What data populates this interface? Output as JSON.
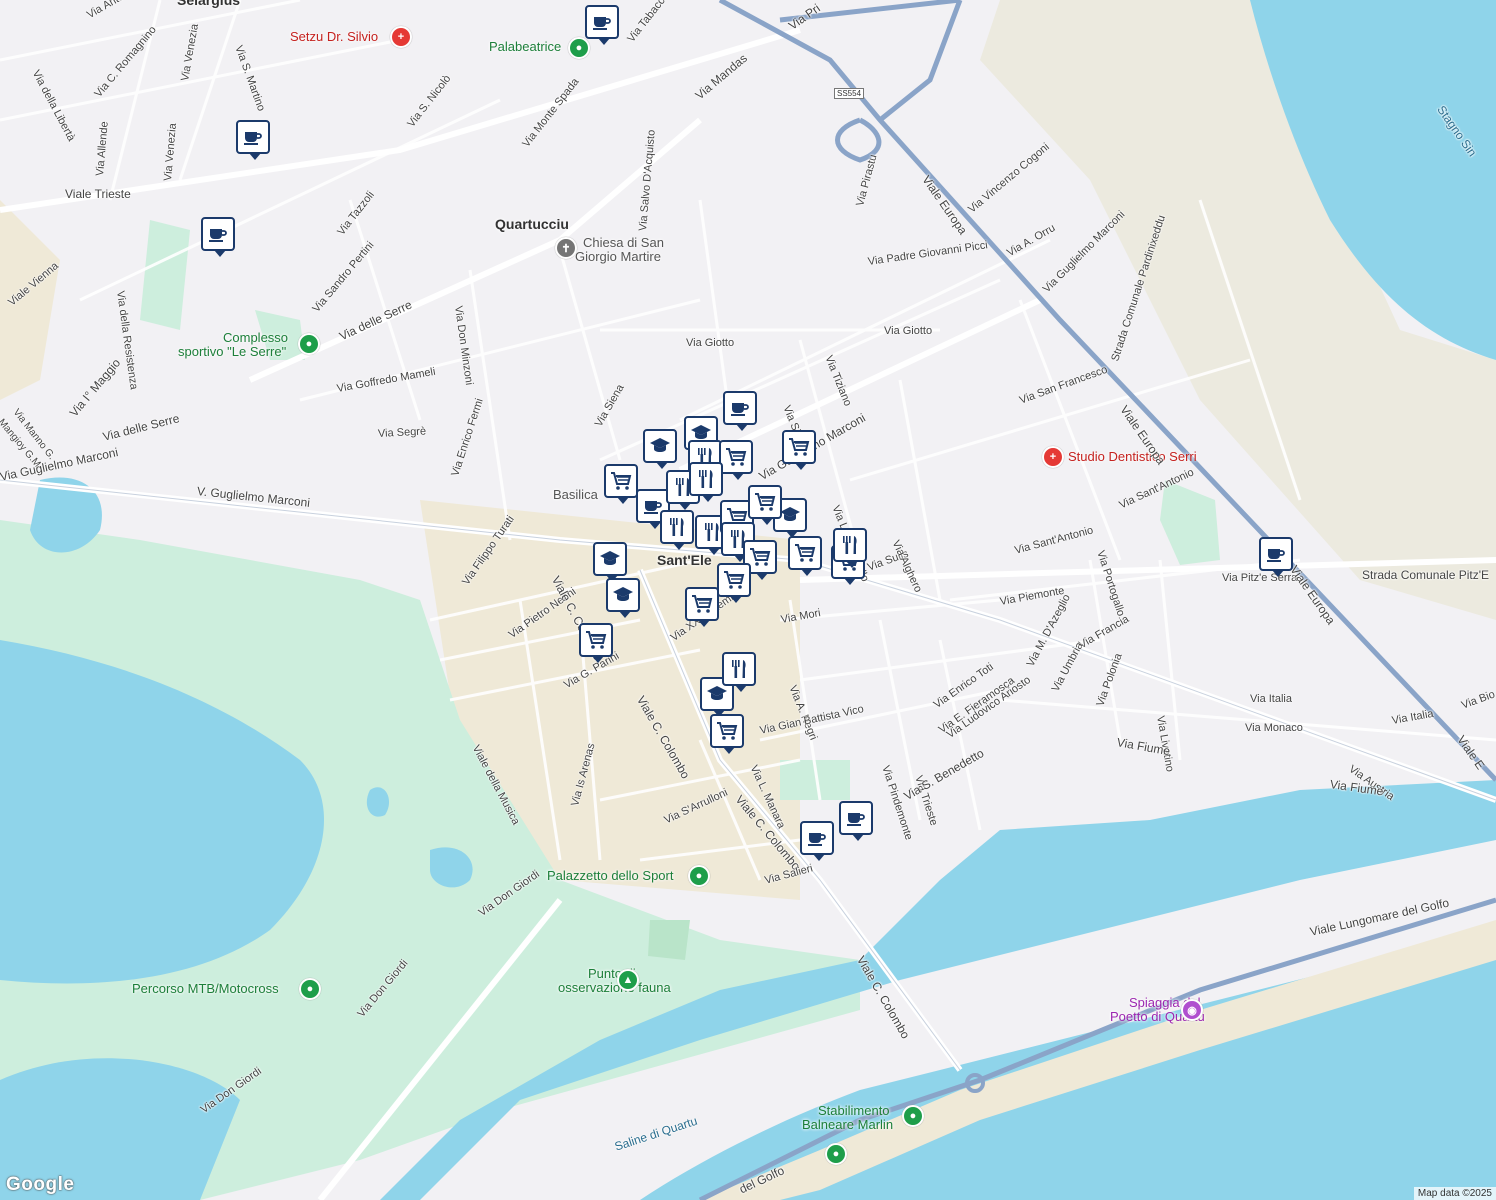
{
  "colors": {
    "water": "#8fd4ea",
    "park": "#cdeedd",
    "sand": "#efe9d7",
    "road_major": "#8aa4c8",
    "marker": "#1b3a6b"
  },
  "places": {
    "selargius": "Selargius",
    "quartucciu": "Quartucciu",
    "santelena": "Sant'Ele",
    "basilica": "Basilica"
  },
  "pois": {
    "setzu": "Setzu Dr. Silvio",
    "palabeatrice": "Palabeatrice",
    "chiesa1": "Chiesa di San",
    "chiesa2": "Giorgio Martire",
    "complesso1": "Complesso",
    "complesso2": "sportivo \"Le Serre\"",
    "studio": "Studio Dentistico Serri",
    "palazzetto": "Palazzetto dello Sport",
    "punto1": "Punto di",
    "punto2": "osservazione fauna",
    "percorso": "Percorso MTB/Motocross",
    "spiaggia1": "Spiaggia del",
    "spiaggia2": "Poetto di Quartu",
    "stabilimento1": "Stabilimento",
    "stabilimento2": "Balneare Marlin",
    "ss554": "SS554",
    "saline": "Saline di Quartu",
    "stagno": "Stagno Sin"
  },
  "streets": {
    "s01": "Via Anto",
    "s02": "Via della Libertà",
    "s03": "Via C. Romagnino",
    "s04": "Via Venezia",
    "s05": "Via S. Martino",
    "s06": "Via S. Nicolò",
    "s07": "Via Venezia",
    "s08": "Via Allende",
    "s09": "Viale Trieste",
    "s10": "Via Tazzoli",
    "s11": "Via Monte Spada",
    "s12": "Via Mandas",
    "s13": "Via Tabacchi",
    "s14": "Via Pri",
    "s15": "Via Salvo D'Acquisto",
    "s16": "Via Pirastu",
    "s17": "Viale Europa",
    "s18": "Via Vincenzo Cogoni",
    "s19": "Via A. Orru",
    "s20": "Via Guglielmo Marconi",
    "s21": "Strada Comunale Pardinixeddu",
    "s22": "Via Padre Giovanni Picci",
    "s23": "Via Giotto",
    "s24": "Via Giotto",
    "s25": "Via Tiziano",
    "s26": "Via Sandro Pertini",
    "s27": "Via della Resistenza",
    "s28": "Viale Vienna",
    "s29": "Via Don Minzoni",
    "s30": "Via delle Serre",
    "s31": "Via Goffredo Mameli",
    "s32": "Via Siena",
    "s33": "Via Segrè",
    "s34": "Via delle Serre",
    "s35": "Via I° Maggio",
    "s36": "Via Manno G.",
    "s37": "Mangioy G.M.",
    "s38": "Via Guglielmo Marconi",
    "s39": "V. Guglielmo Marconi",
    "s40": "Via Enrico Fermi",
    "s41": "Via Filippo Turati",
    "s42": "Via Pietro Nenni",
    "s43": "Viale C. Colombo",
    "s44": "Via G. Parini",
    "s45": "Viale della Musica",
    "s46": "Via Is Arenas",
    "s47": "Viale C. Colombo",
    "s48": "Via XX Settembre",
    "s49": "Via Mori",
    "s50": "Via Guglielmo Marconi",
    "s51": "Via Luigi Merello",
    "s52": "Via Sulis",
    "s53": "Via Alghero",
    "s54": "Via San Francesco",
    "s55": "Viale Europa",
    "s56": "Via Sant'Antonio",
    "s57": "Via Sant'Antonio",
    "s58": "Via Portogallo",
    "s59": "Via Piemonte",
    "s60": "Via Pitz'e Serra",
    "s61": "Strada Comunale Pitz'E",
    "s62": "Viale Europa",
    "s63": "Via M. D'Azeglio",
    "s64": "Via Francia",
    "s65": "Via Umbria",
    "s66": "Via Polonia",
    "s67": "Via Livatino",
    "s68": "Via Italia",
    "s69": "Via Italia",
    "s70": "Via Monaco",
    "s71": "Via Bio",
    "s72": "Viale E",
    "s73": "Via Austria",
    "s74": "Via Fiume",
    "s75": "Via Fiume",
    "s76": "Via A. Negri",
    "s77": "Via Gian Battista Vico",
    "s78": "Via L. Manara",
    "s79": "Via Pindemonte",
    "s80": "Via Trieste",
    "s81": "Via Enrico Toti",
    "s82": "Via E. Fieramosca",
    "s83": "Via Ludovico Ariosto",
    "s84": "Via S. Benedetto",
    "s85": "Via S'Arrulloni",
    "s86": "Viale C. Colombo",
    "s87": "Via Salieri",
    "s88": "Via Don Giordi",
    "s89": "Via Don Giordi",
    "s90": "Via Don Giordi",
    "s91": "Viale C. Colombo",
    "s92": "Viale Lungomare del Golfo",
    "s93": "del Golfo",
    "s94": "Via Sig"
  },
  "markers": [
    {
      "icon": "cafe"
    },
    {
      "icon": "cafe"
    },
    {
      "icon": "cafe"
    },
    {
      "icon": "cafe"
    },
    {
      "icon": "school"
    },
    {
      "icon": "school"
    },
    {
      "icon": "restaurant"
    },
    {
      "icon": "grocery"
    },
    {
      "icon": "grocery"
    },
    {
      "icon": "grocery"
    },
    {
      "icon": "cafe"
    },
    {
      "icon": "restaurant"
    },
    {
      "icon": "restaurant"
    },
    {
      "icon": "restaurant"
    },
    {
      "icon": "restaurant"
    },
    {
      "icon": "school"
    },
    {
      "icon": "grocery"
    },
    {
      "icon": "grocery"
    },
    {
      "icon": "restaurant"
    },
    {
      "icon": "grocery"
    },
    {
      "icon": "grocery"
    },
    {
      "icon": "school"
    },
    {
      "icon": "school"
    },
    {
      "icon": "grocery"
    },
    {
      "icon": "grocery"
    },
    {
      "icon": "restaurant"
    },
    {
      "icon": "school"
    },
    {
      "icon": "grocery"
    },
    {
      "icon": "cafe"
    },
    {
      "icon": "cafe"
    },
    {
      "icon": "cafe"
    },
    {
      "icon": "grocery"
    },
    {
      "icon": "restaurant"
    },
    {
      "icon": "grocery"
    }
  ],
  "branding": {
    "logo": "Google",
    "attribution": "Map data ©2025"
  }
}
